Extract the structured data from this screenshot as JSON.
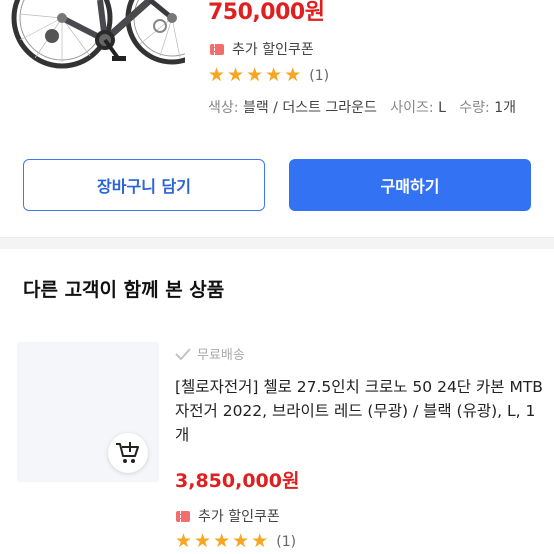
{
  "product": {
    "price": "750,000원",
    "coupon_text": "추가 할인쿠폰",
    "rating_count": "(1)",
    "option_color_label": "색상:",
    "option_color_value": "블랙 / 더스트 그라운드",
    "option_size_label": "사이즈:",
    "option_size_value": "L",
    "option_qty_label": "수량:",
    "option_qty_value": "1개",
    "rating_stars": 5
  },
  "actions": {
    "add_to_cart_label": "장바구니 담기",
    "buy_label": "구매하기"
  },
  "recommend": {
    "section_title": "다른 고객이 함께 본 상품",
    "item": {
      "shipping": "무료배송",
      "title": "[첼로자전거] 첼로 27.5인치 크로노 50 24단 카본 MTB 자전거 2022, 브라이트 레드 (무광) / 블랙 (유광), L, 1개",
      "price": "3,850,000원",
      "coupon_text": "추가 할인쿠폰",
      "rating_count": "(1)",
      "rating_stars": 5
    }
  },
  "colors": {
    "price_red": "#e02020",
    "primary_blue": "#3372f2",
    "star": "#f5a623"
  }
}
